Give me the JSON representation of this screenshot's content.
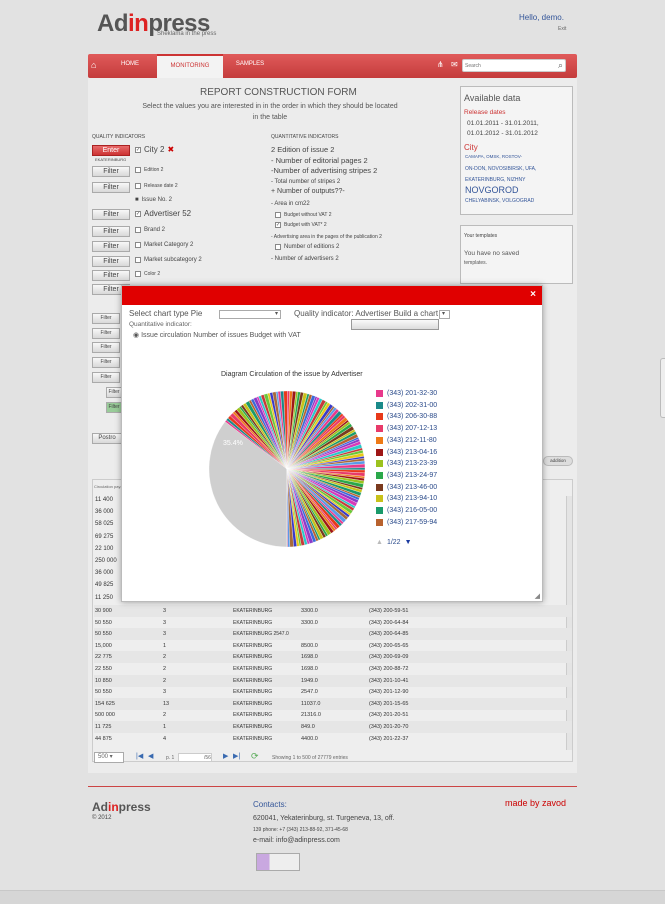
{
  "header": {
    "logo_pre": "Ad",
    "logo_red": "in",
    "logo_post": "press",
    "logo_sub": "Sheklama in the press",
    "hello": "Hello, demo.",
    "exit": "Exit"
  },
  "nav": {
    "home": "HOME",
    "monitoring": "MONITORING",
    "samples": "SAMPLES",
    "search_placeholder": "Search"
  },
  "report": {
    "title": "REPORT CONSTRUCTION FORM",
    "note": "Select the values you are interested in in the order in which they should be located in the table"
  },
  "quality": {
    "heading": "QUALITY INDICATORS",
    "filter_enter": "Enter",
    "filter": "Filter",
    "city_sub": "EKATERINBURG",
    "items": [
      "City 2",
      "Edition 2",
      "Release date 2",
      "Issue No. 2",
      "Advertiser 52",
      "Brand 2",
      "Market Category 2",
      "Market subcategory 2",
      "Color 2"
    ]
  },
  "quantitative": {
    "heading": "QUANTITATIVE INDICATORS",
    "items": [
      "2 Edition of issue 2",
      "- Number of editorial pages 2",
      "-Number of advertising stripes 2",
      "- Total number of stripes 2",
      "+ Number of outputs??-",
      "- Area in cm22",
      "Budget without VAT 2",
      "Budget with VAT* 2",
      "- Advertising area in the pages of the publication 2",
      "Number of editions 2",
      "- Number of advertisers 2"
    ]
  },
  "side": {
    "available_title": "Available data",
    "release_label": "Release dates",
    "date1": "01.01.2011 - 31.01.2011,",
    "date2": "01.01.2012 - 31.01.2012",
    "city_label": "City",
    "cities_a": "САМАРА, OMSK, ROSTOV-",
    "cities_b": "ON-DON, NOVOSIBIRSK, UFA,",
    "cities_c": "EKATERINBURG, NIZHNY",
    "cities_d": "NOVGOROD",
    "cities_e": "CHELYABINSK, VOLGOGRAD",
    "templates_title": "Your templates",
    "templates_none_a": "You have no saved",
    "templates_none_b": "templates."
  },
  "left_stubs": {
    "filter": "Filter",
    "postro": "Postro",
    "addition": "addition"
  },
  "modal": {
    "close": "×",
    "chart_type_label": "Select chart type Pie",
    "chart_type_value": "",
    "quality_label": "Quality indicator: Advertiser Build a chart",
    "quant_label": "Quantitative indicator:",
    "radio_label": "Issue circulation Number of issues Budget with VAT",
    "build_button": "",
    "pager_text": "1/22"
  },
  "chart_data": {
    "type": "pie",
    "title": "Diagram Circulation of the issue by Advertiser",
    "annotation": "35.4%",
    "dominant_share": 35.4,
    "legend": [
      {
        "label": "(343) 201-32-30",
        "color": "#e8398c"
      },
      {
        "label": "(343) 202-31-00",
        "color": "#1a8a8a"
      },
      {
        "label": "(343) 206-30-88",
        "color": "#e8391a"
      },
      {
        "label": "(343) 207-12-13",
        "color": "#e83a6a"
      },
      {
        "label": "(343) 212-11-80",
        "color": "#ee7a16"
      },
      {
        "label": "(343) 213-04-16",
        "color": "#9e1616"
      },
      {
        "label": "(343) 213-23-39",
        "color": "#9cc21e"
      },
      {
        "label": "(343) 213-24-97",
        "color": "#2aa84a"
      },
      {
        "label": "(343) 213-46-00",
        "color": "#7a3a1e"
      },
      {
        "label": "(343) 213-94-10",
        "color": "#c8c21a"
      },
      {
        "label": "(343) 216-05-00",
        "color": "#1a9a6a"
      },
      {
        "label": "(343) 217-59-94",
        "color": "#b8622e"
      }
    ]
  },
  "table": {
    "top_left_values": [
      "11 400",
      "36 000",
      "58 025",
      "69 275",
      "22 100",
      "250 000",
      "36 000",
      "49 825",
      "11 250"
    ],
    "rows": [
      [
        "30 900",
        "3",
        "EKATERINBURG",
        "3300.0",
        "(343) 200-59-51"
      ],
      [
        "50 550",
        "3",
        "EKATERINBURG",
        "3300.0",
        "(343) 200-64-84"
      ],
      [
        "50 550",
        "3",
        "EKATERINBURG 2547.0",
        "",
        "(343) 200-64-85"
      ],
      [
        "15,000",
        "1",
        "EKATERINBURG",
        "8500.0",
        "(343) 200-65-65"
      ],
      [
        "22 775",
        "2",
        "EKATERINBURG",
        "1698.0",
        "(343) 200-69-09"
      ],
      [
        "22 550",
        "2",
        "EKATERINBURG",
        "1698.0",
        "(343) 200-88-72"
      ],
      [
        "10 850",
        "2",
        "EKATERINBURG",
        "1949.0",
        "(343) 201-10-41"
      ],
      [
        "50 550",
        "3",
        "EKATERINBURG",
        "2547.0",
        "(343) 201-12-90"
      ],
      [
        "154 625",
        "13",
        "EKATERINBURG",
        "11037.0",
        "(343) 201-15-65"
      ],
      [
        "500 000",
        "2",
        "EKATERINBURG",
        "21316.0",
        "(343) 201-20-51"
      ],
      [
        "11 725",
        "1",
        "EKATERINBURG",
        "849.0",
        "(343) 201-20-70"
      ],
      [
        "44 875",
        "4",
        "EKATERINBURG",
        "4400.0",
        "(343) 201-22-37"
      ]
    ],
    "per_page": "500",
    "page_label": "p. 1",
    "page_of": "/56",
    "showing": "Showing 1 to 500 of 27779 entries",
    "circ_header": "Circulation pay..."
  },
  "footer": {
    "logo_pre": "Ad",
    "logo_red": "in",
    "logo_post": "press",
    "copyright": "© 2012",
    "contacts": "Contacts:",
    "address": "620041, Yekaterinburg, st. Turgeneva, 13, off.",
    "phone": "139 phone: +7 (343) 213-88-92, 371-45-68",
    "email": "e-mail: info@adinpress.com",
    "madeby": "made by zavod"
  }
}
